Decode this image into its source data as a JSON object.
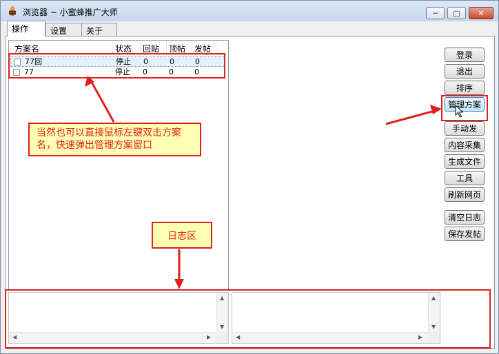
{
  "window": {
    "title": "浏览器 ~ 小蜜蜂推广大师"
  },
  "tabs": [
    {
      "label": "操作",
      "active": true
    },
    {
      "label": "设置",
      "active": false
    },
    {
      "label": "关于",
      "active": false
    }
  ],
  "list": {
    "columns": [
      "方案名",
      "状态",
      "回贴",
      "顶帖",
      "发帖"
    ],
    "rows": [
      {
        "name": "77回",
        "status": "停止",
        "reply": "0",
        "top": "0",
        "post": "0",
        "selected": true
      },
      {
        "name": "77",
        "status": "停止",
        "reply": "0",
        "top": "0",
        "post": "0",
        "selected": false
      }
    ]
  },
  "buttons": {
    "login": "登录",
    "logout": "退出",
    "sort": "排序",
    "manage": "管理方案",
    "manual_post": "手动发",
    "collect": "内容采集",
    "generate": "生成文件",
    "tools": "工具",
    "refresh": "刷新网页",
    "clear_log": "清空日志",
    "save_posts": "保存发帖"
  },
  "annotations": {
    "double_click_note": "当然也可以直接鼠标左键双击方案名，快速弹出管理方案窗口",
    "log_area_label": "日志区"
  },
  "colors": {
    "annotation_red": "#e0201e",
    "note_background": "#ffffb4",
    "selected_row": "#e8f1fb"
  }
}
